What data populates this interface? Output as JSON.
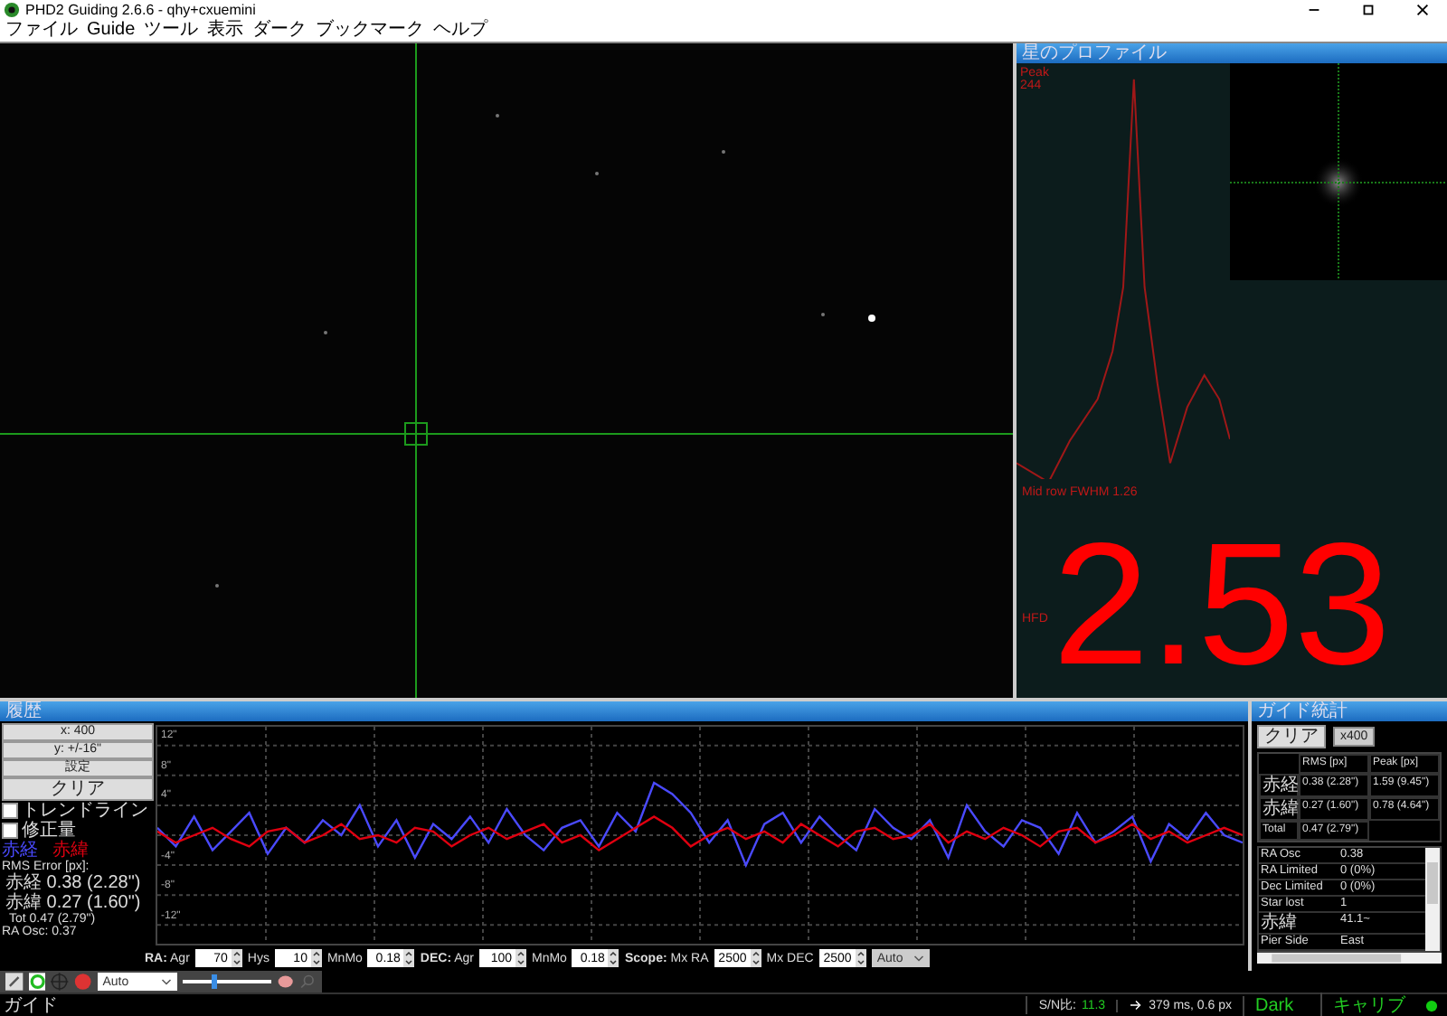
{
  "window": {
    "title": "PHD2 Guiding 2.6.6 - qhy+cxuemini"
  },
  "menu": [
    "ファイル",
    "Guide",
    "ツール",
    "表示",
    "ダーク",
    "ブックマーク",
    "ヘルプ"
  ],
  "profile": {
    "title": "星のプロファイル",
    "peak_label": "Peak",
    "peak_value": "244",
    "fwhm": "Mid row FWHM 1.26",
    "hfd_label": "HFD",
    "hfd_value": "2.53"
  },
  "graph": {
    "title": "履歴",
    "x_scale": "x: 400",
    "y_scale": "y: +/-16\"",
    "settings": "設定",
    "clear": "クリア",
    "options": [
      {
        "label": "トレンドライン",
        "checked": false
      },
      {
        "label": "修正量",
        "checked": false
      }
    ],
    "rms_title": "RMS Error [px]:",
    "rms": [
      "赤経 0.38 (2.28\")",
      "赤緯 0.27 (1.60\")",
      "Tot 0.47 (2.79\")"
    ],
    "ra_osc": "RA Osc: 0.37",
    "chart_data": {
      "type": "line",
      "grid": true,
      "ylim": [
        -14.5,
        14.5
      ],
      "yticks": [
        {
          "value": 12,
          "label": "12\""
        },
        {
          "value": 8,
          "label": "8\""
        },
        {
          "value": 4,
          "label": "4\""
        },
        {
          "value": -4,
          "label": "-4\""
        },
        {
          "value": -8,
          "label": "-8\""
        },
        {
          "value": -12,
          "label": "-12\""
        }
      ],
      "series": [
        {
          "name": "赤経",
          "color": "#4a4aff",
          "values": [
            1,
            -1.5,
            2.5,
            -2,
            0.5,
            3,
            -2.5,
            1,
            -1,
            2,
            0,
            4,
            -1.5,
            2,
            -3,
            1.5,
            -0.5,
            2.5,
            -1,
            3.5,
            0,
            -2,
            1,
            2,
            -1.5,
            3,
            0.5,
            7,
            5.5,
            3,
            -1,
            2,
            -4,
            1.5,
            3,
            -1,
            2.5,
            0,
            -2,
            3.5,
            1,
            -0.5,
            2,
            -3,
            4,
            0.5,
            -1.5,
            2,
            1,
            -2.5,
            3,
            -1,
            0.5,
            2.5,
            -3.5,
            1.5,
            -0.5,
            3,
            0,
            -1
          ]
        },
        {
          "name": "赤緯",
          "color": "#e00010",
          "values": [
            0.5,
            -1,
            0,
            1,
            -0.5,
            -1.5,
            0.5,
            1,
            -1,
            0,
            1.5,
            -0.5,
            0,
            -1,
            1,
            0.5,
            -1.5,
            0,
            1,
            -0.5,
            0.5,
            1.5,
            -1,
            0,
            -2,
            -0.5,
            1,
            2.5,
            1,
            -1.5,
            0,
            1,
            -0.5,
            0.5,
            -1,
            1.5,
            0,
            -1.5,
            0.5,
            1,
            -0.5,
            0,
            1.5,
            -1,
            0.5,
            -0.5,
            1,
            0,
            -1.5,
            0.5,
            1,
            -1,
            0,
            1.5,
            -0.5,
            0.5,
            -1,
            0,
            1,
            0
          ]
        }
      ]
    },
    "controls": [
      {
        "label": "**RA:** Agr",
        "value": "70"
      },
      {
        "label": "Hys",
        "value": "10"
      },
      {
        "label": "MnMo",
        "value": "0.18"
      },
      {
        "label": "**DEC:** Agr",
        "value": "100"
      },
      {
        "label": "MnMo",
        "value": "0.18"
      },
      {
        "label": "**Scope:** Mx RA",
        "value": "2500"
      },
      {
        "label": "Mx DEC",
        "value": "2500"
      }
    ],
    "mode": "Auto"
  },
  "stats": {
    "title": "ガイド統計",
    "clear": "クリア",
    "scale": "x400",
    "columns": [
      "RMS [px]",
      "Peak [px]"
    ],
    "rows": [
      {
        "label": "赤経",
        "rms": "0.38 (2.28\")",
        "peak": "1.59 (9.45\")"
      },
      {
        "label": "赤緯",
        "rms": "0.27 (1.60\")",
        "peak": "0.78 (4.64\")"
      },
      {
        "label": "Total",
        "rms": "0.47 (2.79\")"
      }
    ],
    "details": [
      {
        "label": "RA Osc",
        "value": "0.38"
      },
      {
        "label": "RA Limited",
        "value": "0 (0%)"
      },
      {
        "label": "Dec Limited",
        "value": "0 (0%)"
      },
      {
        "label": "Star lost",
        "value": "1"
      },
      {
        "label": "赤緯",
        "value": "41.1~"
      },
      {
        "label": "Pier Side",
        "value": "East"
      }
    ]
  },
  "toolbar": {
    "exposure": "Auto",
    "slider": {
      "level": 0.35
    }
  },
  "status": {
    "message": "ガイド",
    "snr_label": "S/N比:",
    "snr": "11.3",
    "exposure": "379 ms, 0.6 px",
    "dark": "Dark",
    "calibration": "キャリブ"
  }
}
